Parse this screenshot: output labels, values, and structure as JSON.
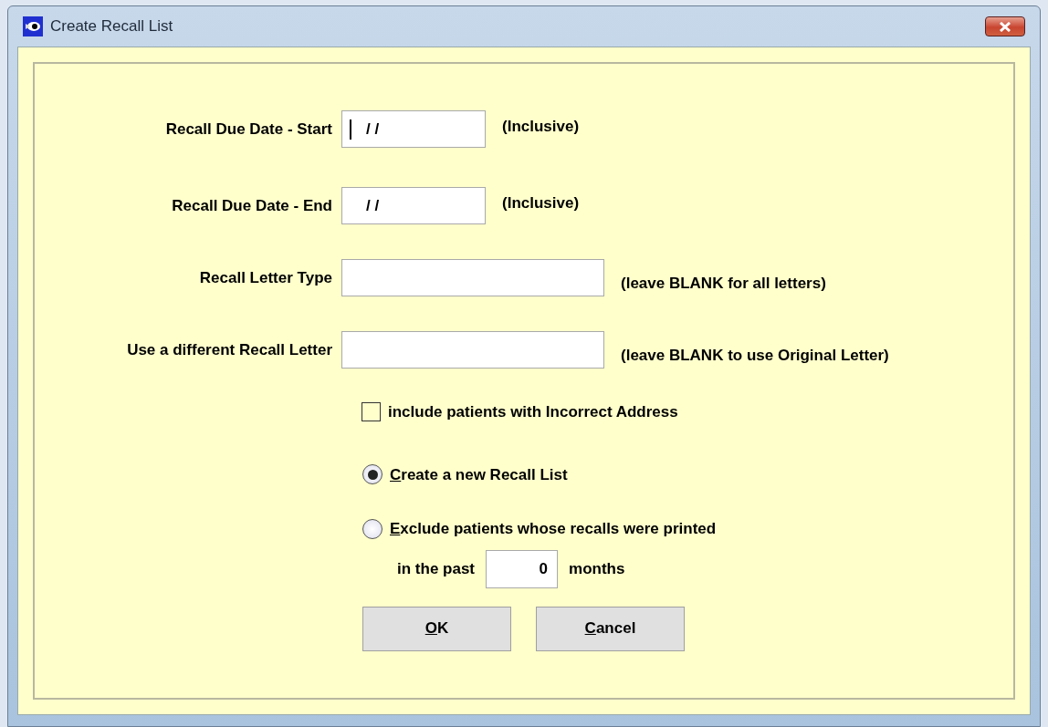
{
  "window": {
    "title": "Create Recall List"
  },
  "fields": [
    {
      "label": "Recall Due Date - Start",
      "value": "/ /",
      "focused": true,
      "kind": "date",
      "note": "(Inclusive)"
    },
    {
      "label": "Recall Due Date - End",
      "value": "/ /",
      "focused": false,
      "kind": "date",
      "note": "(Inclusive)"
    },
    {
      "label": "Recall Letter Type",
      "focused": false,
      "kind": "text",
      "note": "(leave BLANK for all letters)"
    },
    {
      "label": "Use a different Recall Letter",
      "focused": false,
      "kind": "text",
      "note": "(leave BLANK to use Original Letter)"
    }
  ],
  "checkbox": {
    "label": "include patients with Incorrect Address",
    "checked": false
  },
  "radios": [
    {
      "label": "Create a new Recall List",
      "selected": true,
      "underline_first": true
    },
    {
      "label": "Exclude patients whose recalls were printed",
      "selected": false,
      "underline_first": true
    }
  ],
  "past": {
    "prefix": "in the past",
    "value": "0",
    "suffix": "months"
  },
  "buttons": [
    {
      "label": "OK",
      "underline_first": true
    },
    {
      "label": "Cancel",
      "underline_first": true
    }
  ]
}
